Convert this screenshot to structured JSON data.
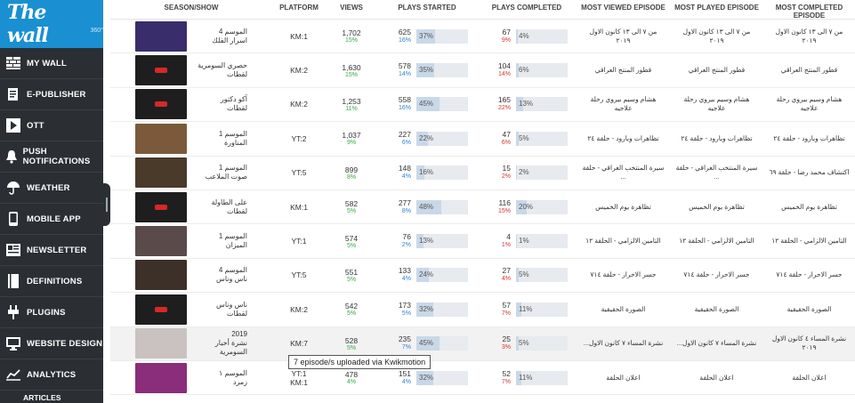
{
  "logo": {
    "text": "The wall",
    "sup": "360°"
  },
  "sidebar": {
    "items": [
      {
        "label": "MY WALL",
        "icon": "wall-icon"
      },
      {
        "label": "E-PUBLISHER",
        "icon": "publisher-icon"
      },
      {
        "label": "OTT",
        "icon": "play-icon"
      },
      {
        "label": "PUSH NOTIFICATIONS",
        "icon": "bell-icon"
      },
      {
        "label": "WEATHER",
        "icon": "umbrella-icon"
      },
      {
        "label": "MOBILE APP",
        "icon": "phone-icon"
      },
      {
        "label": "NEWSLETTER",
        "icon": "newsletter-icon"
      },
      {
        "label": "DEFINITIONS",
        "icon": "book-icon"
      },
      {
        "label": "PLUGINS",
        "icon": "plug-icon"
      },
      {
        "label": "WEBSITE DESIGN",
        "icon": "monitor-icon"
      },
      {
        "label": "ANALYTICS",
        "icon": "chart-icon"
      }
    ],
    "sub_item": "ARTICLES"
  },
  "table": {
    "headers": [
      "SEASON/SHOW",
      "PLATFORM",
      "VIEWS",
      "PLAYS STARTED",
      "PLAYS COMPLETED",
      "MOST VIEWED EPISODE",
      "MOST PLAYED EPISODE",
      "MOST COMPLETED EPISODE"
    ],
    "rows": [
      {
        "show": [
          "الموسم 4",
          "اسرار الفلك"
        ],
        "platform": [
          "KM:1"
        ],
        "views": "1,702",
        "views_pct": "15%",
        "ps": "625",
        "ps_pct": "16%",
        "ps_bar": "37%",
        "pc": "67",
        "pc_pct": "9%",
        "pc_bar": "4%",
        "mv": "من ٧ الى ١٣ كانون الاول ٢٠١٩",
        "mp": "من ٧ الى ١٣ كانون الاول ٢٠١٩",
        "mc": "من ٧ الى ١٣ كانون الاول ٢٠١٩",
        "thumb": "#3a2d6b",
        "badge": false
      },
      {
        "show": [
          "حصري السومرية",
          "لقطات"
        ],
        "platform": [
          "KM:2"
        ],
        "views": "1,630",
        "views_pct": "15%",
        "ps": "578",
        "ps_pct": "14%",
        "ps_bar": "35%",
        "pc": "104",
        "pc_pct": "14%",
        "pc_bar": "6%",
        "mv": "قطور المنتج العراقي",
        "mp": "قطور المنتج العراقي",
        "mc": "قطور المنتج العراقي",
        "thumb": "#1e1e1e",
        "badge": true
      },
      {
        "show": [
          "آكو دكتور",
          "لقطات"
        ],
        "platform": [
          "KM:2"
        ],
        "views": "1,253",
        "views_pct": "11%",
        "ps": "558",
        "ps_pct": "16%",
        "ps_bar": "45%",
        "pc": "165",
        "pc_pct": "22%",
        "pc_bar": "13%",
        "mv": "هشام وسيم بيروي رحلة علاجيه",
        "mp": "هشام وسيم بيروي رحلة علاجيه",
        "mc": "هشام وسيم بيروي رحلة علاجيه",
        "thumb": "#1e1e1e",
        "badge": true
      },
      {
        "show": [
          "الموسم 1",
          "المناورة"
        ],
        "platform": [
          "YT:2"
        ],
        "views": "1,037",
        "views_pct": "9%",
        "ps": "227",
        "ps_pct": "6%",
        "ps_bar": "22%",
        "pc": "47",
        "pc_pct": "6%",
        "pc_bar": "5%",
        "mv": "تظاهرات وبارود - حلقة ٢٤",
        "mp": "تظاهرات وبارود - حلقة ٢٤",
        "mc": "تظاهرات وبارود - حلقة ٢٤",
        "thumb": "#7a5a3a",
        "badge": false
      },
      {
        "show": [
          "الموسم 1",
          "صوت الملاعب"
        ],
        "platform": [
          "YT:5"
        ],
        "views": "899",
        "views_pct": "8%",
        "ps": "148",
        "ps_pct": "4%",
        "ps_bar": "16%",
        "pc": "15",
        "pc_pct": "2%",
        "pc_bar": "2%",
        "mv": "سيرة المنتخب العراقي - حلقة ...",
        "mp": "سيرة المنتخب العراقي - حلقة ...",
        "mc": "اكتشاف محمد رضا - حلقة ٦٩",
        "thumb": "#4a3a2a",
        "badge": false
      },
      {
        "show": [
          "على الطاولة",
          "لقطات"
        ],
        "platform": [
          "KM:1"
        ],
        "views": "582",
        "views_pct": "5%",
        "ps": "277",
        "ps_pct": "8%",
        "ps_bar": "48%",
        "pc": "116",
        "pc_pct": "15%",
        "pc_bar": "20%",
        "mv": "تظاهرة يوم الخميس",
        "mp": "تظاهرة يوم الخميس",
        "mc": "تظاهرة يوم الخميس",
        "thumb": "#1e1e1e",
        "badge": true
      },
      {
        "show": [
          "الموسم 1",
          "الميزان"
        ],
        "platform": [
          "YT:1"
        ],
        "views": "574",
        "views_pct": "5%",
        "ps": "76",
        "ps_pct": "2%",
        "ps_bar": "13%",
        "pc": "4",
        "pc_pct": "1%",
        "pc_bar": "1%",
        "mv": "التامين الالزامي - الحلقة ١٢",
        "mp": "التامين الالزامي - الحلقة ١٢",
        "mc": "التامين الالزامي - الحلقة ١٢",
        "thumb": "#5b4a4a",
        "badge": false
      },
      {
        "show": [
          "الموسم 4",
          "ناس وناس"
        ],
        "platform": [
          "YT:5"
        ],
        "views": "551",
        "views_pct": "5%",
        "ps": "133",
        "ps_pct": "4%",
        "ps_bar": "24%",
        "pc": "27",
        "pc_pct": "4%",
        "pc_bar": "5%",
        "mv": "جسر الاحرار - حلقة ٧١٤",
        "mp": "جسر الاحرار - حلقة ٧١٤",
        "mc": "جسر الاحرار - حلقة ٧١٤",
        "thumb": "#3d3028",
        "badge": false
      },
      {
        "show": [
          "ناس وناس",
          "لقطات"
        ],
        "platform": [
          "KM:2"
        ],
        "views": "542",
        "views_pct": "5%",
        "ps": "173",
        "ps_pct": "5%",
        "ps_bar": "32%",
        "pc": "57",
        "pc_pct": "7%",
        "pc_bar": "11%",
        "mv": "الصورة الحقيقية",
        "mp": "الصورة الحقيقية",
        "mc": "الصورة الحقيقية",
        "thumb": "#1e1e1e",
        "badge": true
      },
      {
        "show": [
          "2019",
          "نشرة أخبار",
          "السومرية"
        ],
        "platform": [
          "KM:7"
        ],
        "views": "528",
        "views_pct": "5%",
        "ps": "235",
        "ps_pct": "7%",
        "ps_bar": "45%",
        "pc": "25",
        "pc_pct": "3%",
        "pc_bar": "5%",
        "mv": "نشرة المساء ٧ كانون الاول...",
        "mp": "نشرة المساء ٧ كانون الاول...",
        "mc": "نشرة المساء ٤ كانون الاول ٢٠١٩",
        "thumb": "#c9c2c0",
        "badge": false,
        "highlight": true
      },
      {
        "show": [
          "الموسم ١",
          "زمرد"
        ],
        "platform": [
          "YT:1",
          "KM:1"
        ],
        "views": "478",
        "views_pct": "4%",
        "ps": "151",
        "ps_pct": "4%",
        "ps_bar": "32%",
        "pc": "52",
        "pc_pct": "7%",
        "pc_bar": "11%",
        "mv": "اعلان الحلقة",
        "mp": "اعلان الحلقة",
        "mc": "اعلان الحلقة",
        "thumb": "#8a2d7a",
        "badge": false
      }
    ]
  },
  "tooltip": "7 episode/s uploaded via Kwikmotion"
}
